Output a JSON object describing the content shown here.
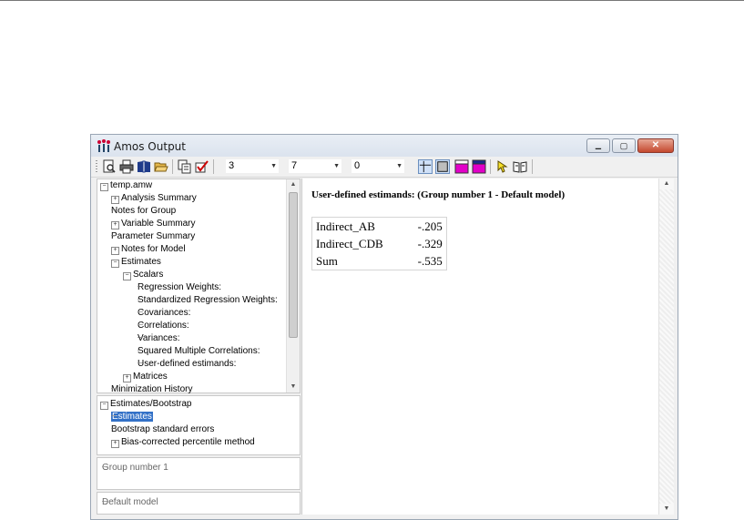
{
  "window": {
    "title": "Amos Output",
    "min_glyph": "▁",
    "max_glyph": "▢",
    "close_glyph": "✕"
  },
  "toolbar": {
    "combos": [
      {
        "value": "3"
      },
      {
        "value": "7"
      },
      {
        "value": "0"
      }
    ],
    "dropdown_glyph": "▼"
  },
  "tree": {
    "root": "temp.amw",
    "items": [
      {
        "label": "Analysis Summary"
      },
      {
        "label": "Notes for Group"
      },
      {
        "label": "Variable Summary"
      },
      {
        "label": "Parameter Summary"
      },
      {
        "label": "Notes for Model"
      },
      {
        "label": "Estimates"
      },
      {
        "label": "Scalars"
      },
      {
        "label": "Regression Weights:"
      },
      {
        "label": "Standardized Regression Weights:"
      },
      {
        "label": "Covariances:"
      },
      {
        "label": "Correlations:"
      },
      {
        "label": "Variances:"
      },
      {
        "label": "Squared Multiple Correlations:"
      },
      {
        "label": "User-defined estimands:"
      },
      {
        "label": "Matrices"
      },
      {
        "label": "Minimization History"
      }
    ]
  },
  "bootstrap": {
    "root": "Estimates/Bootstrap",
    "items": [
      {
        "label": "Estimates"
      },
      {
        "label": "Bootstrap standard errors"
      },
      {
        "label": "Bias-corrected percentile method"
      }
    ]
  },
  "groups": {
    "item": "Group number 1"
  },
  "models": {
    "item": "Default model"
  },
  "main": {
    "heading": "User-defined estimands: (Group number 1 - Default model)",
    "rows": [
      {
        "label": "Indirect_AB",
        "value": "-.205"
      },
      {
        "label": "Indirect_CDB",
        "value": "-.329"
      },
      {
        "label": "Sum",
        "value": "-.535"
      }
    ]
  }
}
